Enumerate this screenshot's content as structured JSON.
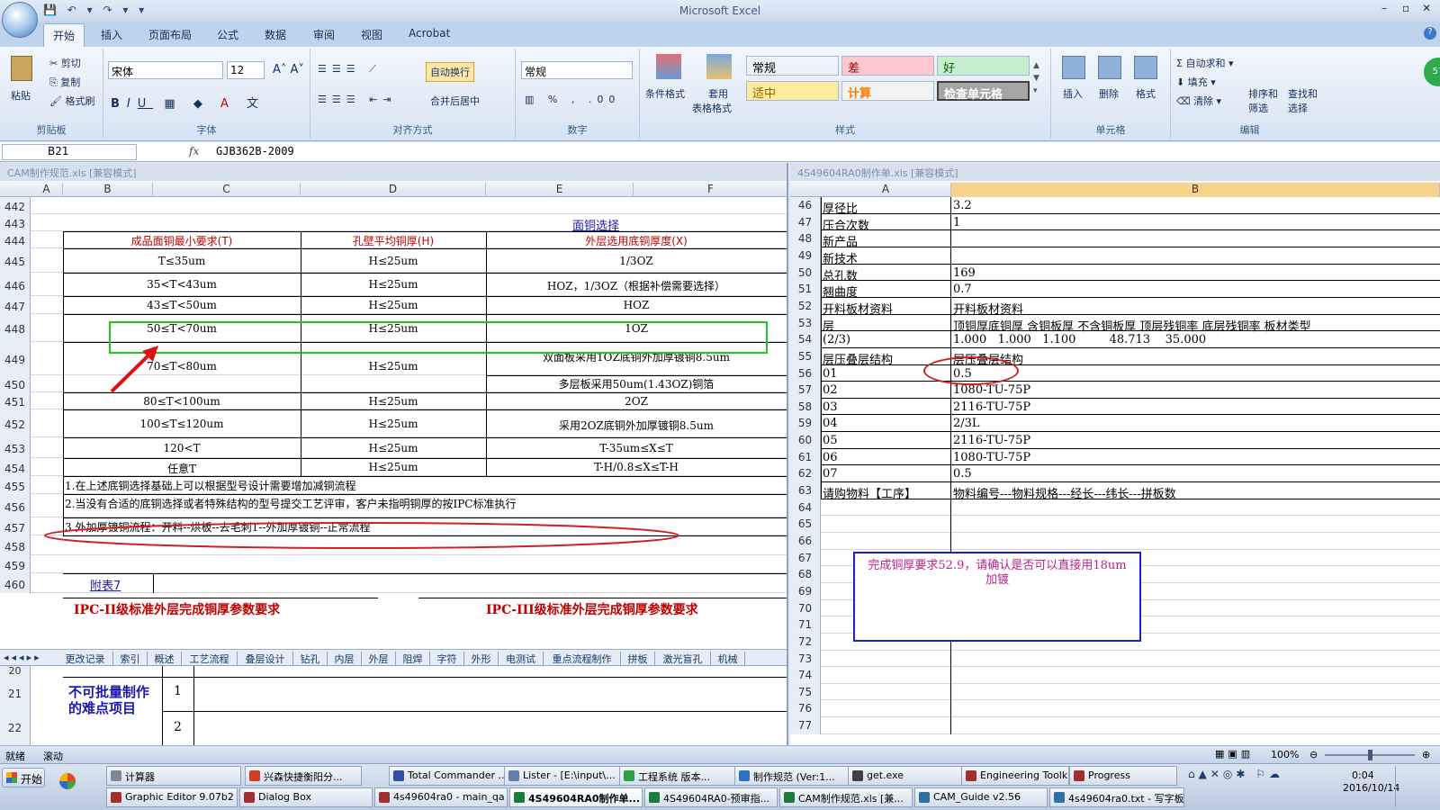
{
  "window": {
    "title": "Microsoft Excel"
  },
  "menu_tabs": [
    "开始",
    "插入",
    "页面布局",
    "公式",
    "数据",
    "审阅",
    "视图",
    "Acrobat"
  ],
  "ribbon": {
    "clipboard": {
      "paste": "粘贴",
      "cut": "剪切",
      "copy": "复制",
      "format_painter": "格式刷",
      "label": "剪贴板"
    },
    "font": {
      "name": "宋体",
      "size": "12",
      "label": "字体"
    },
    "alignment": {
      "wrap": "自动换行",
      "merge": "合并后居中",
      "label": "对齐方式"
    },
    "number": {
      "format": "常规",
      "label": "数字"
    },
    "styles": {
      "cond_format": "条件格式",
      "table_format_1": "套用",
      "table_format_2": "表格格式",
      "label": "样式",
      "items": [
        {
          "t": "常规",
          "bg": "#ffffff",
          "c": "#000000"
        },
        {
          "t": "差",
          "bg": "#ffc7ce",
          "c": "#9c0006"
        },
        {
          "t": "好",
          "bg": "#c6efce",
          "c": "#006100"
        },
        {
          "t": "适中",
          "bg": "#ffeb9c",
          "c": "#9c6500"
        },
        {
          "t": "计算",
          "bg": "#f2f2f2",
          "c": "#fa7d00"
        },
        {
          "t": "检查单元格",
          "bg": "#a5a5a5",
          "c": "#ffffff"
        }
      ]
    },
    "cells": {
      "insert": "插入",
      "delete": "删除",
      "format": "格式",
      "label": "单元格"
    },
    "editing": {
      "autosum": "自动求和",
      "fill": "填充",
      "clear": "清除",
      "sort1": "排序和",
      "sort2": "筛选",
      "find1": "查找和",
      "find2": "选择",
      "label": "编辑"
    }
  },
  "formula_bar": {
    "name_box": "B21",
    "fx": "fx",
    "value": "GJB362B-2009"
  },
  "left_window": {
    "title": "CAM制作规范.xls  [兼容模式]",
    "columns": [
      "A",
      "B",
      "C",
      "D",
      "E",
      "F"
    ],
    "rows": [
      "442",
      "443",
      "444",
      "445",
      "446",
      "447",
      "448",
      "449",
      "450",
      "451",
      "452",
      "453",
      "454",
      "455",
      "456",
      "457",
      "458",
      "459",
      "460"
    ],
    "section_title": "面铜选择",
    "headers": [
      "成品面铜最小要求(T)",
      "孔壁平均铜厚(H)",
      "外层选用底铜厚度(X)"
    ],
    "table": [
      [
        "T≤35um",
        "H≤25um",
        "1/3OZ"
      ],
      [
        "35<T<43um",
        "H≤25um",
        "HOZ，1/3OZ（根据补偿需要选择）"
      ],
      [
        "43≤T<50um",
        "H≤25um",
        "HOZ"
      ],
      [
        "50≤T<70um",
        "H≤25um",
        "1OZ"
      ],
      [
        "70≤T<80um",
        "H≤25um",
        "双面板采用1OZ底铜外加厚镀铜8.5um"
      ],
      [
        "",
        "",
        "多层板采用50um(1.43OZ)铜箔"
      ],
      [
        "80≤T<100um",
        "H≤25um",
        "2OZ"
      ],
      [
        "100≤T≤120um",
        "H≤25um",
        "采用2OZ底铜外加厚镀铜8.5um"
      ],
      [
        "120<T",
        "H≤25um",
        "T-35um≤X≤T"
      ],
      [
        "任意T",
        "H≤25um",
        "T-H/0.8≤X≤T-H"
      ]
    ],
    "notes": [
      "1.在上述底铜选择基础上可以根据型号设计需要增加减铜流程",
      "2.当没有合适的底铜选择或者特殊结构的型号提交工艺评审，客户未指明铜厚的按IPC标准执行",
      "3.外加厚镀铜流程：开料--烘板--去毛刺1--外加厚镀铜--正常流程"
    ],
    "appendix": "附表7",
    "ipc2": "IPC-II级标准外层完成铜厚参数要求",
    "ipc3": "IPC-III级标准外层完成铜厚参数要求",
    "sheet_tabs": [
      "更改记录",
      "索引",
      "概述",
      "工艺流程",
      "叠层设计",
      "钻孔",
      "内层",
      "外层",
      "阻焊",
      "字符",
      "外形",
      "电测试",
      "重点流程制作",
      "拼板",
      "激光盲孔",
      "机械"
    ]
  },
  "bottom_window": {
    "rows": [
      "20",
      "21",
      "22"
    ],
    "difficult": "不可批量制作的难点项目",
    "nums": [
      "1",
      "2"
    ]
  },
  "right_window": {
    "title": "4S49604RA0制作单.xls  [兼容模式]",
    "columns": [
      "A",
      "B"
    ],
    "rows": [
      [
        "46",
        "厚径比",
        "3.2"
      ],
      [
        "47",
        "压合次数",
        "1"
      ],
      [
        "48",
        "新产品",
        ""
      ],
      [
        "49",
        "新技术",
        ""
      ],
      [
        "50",
        "总孔数",
        "169"
      ],
      [
        "51",
        "翘曲度",
        "0.7"
      ],
      [
        "52",
        "开料板材资料",
        "开料板材资料"
      ],
      [
        "53",
        "层",
        "顶铜厚底铜厚 含铜板厚 不含铜板厚 顶层残铜率 底层残铜率 板材类型"
      ],
      [
        "54",
        "(2/3)",
        "1.000   1.000   1.100         48.713    35.000"
      ],
      [
        "55",
        "层压叠层结构",
        "层压叠层结构"
      ],
      [
        "56",
        "01",
        "0.5"
      ],
      [
        "57",
        "02",
        "1080-TU-75P"
      ],
      [
        "58",
        "03",
        "2116-TU-75P"
      ],
      [
        "59",
        "04",
        "2/3L"
      ],
      [
        "60",
        "05",
        "2116-TU-75P"
      ],
      [
        "61",
        "06",
        "1080-TU-75P"
      ],
      [
        "62",
        "07",
        "0.5"
      ],
      [
        "63",
        "请购物料【工序】",
        "物料编号---物料规格---经长---纬长---拼板数"
      ],
      [
        "64",
        "",
        ""
      ],
      [
        "65",
        "",
        ""
      ],
      [
        "66",
        "",
        ""
      ],
      [
        "67",
        "",
        ""
      ],
      [
        "68",
        "",
        ""
      ],
      [
        "69",
        "",
        ""
      ],
      [
        "70",
        "",
        ""
      ],
      [
        "71",
        "",
        ""
      ],
      [
        "72",
        "",
        ""
      ],
      [
        "73",
        "",
        ""
      ],
      [
        "74",
        "",
        ""
      ],
      [
        "75",
        "",
        ""
      ],
      [
        "76",
        "",
        ""
      ],
      [
        "77",
        "",
        ""
      ]
    ],
    "comment": "完成铜厚要求52.9，请确认是否可以直接用18um加镀"
  },
  "status": {
    "ready": "就绪",
    "scroll": "滚动",
    "zoom": "100%"
  },
  "taskbar": {
    "start": "开始",
    "row1": [
      {
        "t": "计算器",
        "c": "#7a8a9a"
      },
      {
        "t": "兴森快捷衡阳分...",
        "c": "#d04020"
      },
      {
        "t": "Total Commander ...",
        "c": "#3050a0"
      },
      {
        "t": "Lister - [E:\\input\\...",
        "c": "#6080b0"
      },
      {
        "t": "工程系统  版本...",
        "c": "#30a040"
      },
      {
        "t": "制作规范 (Ver:1...",
        "c": "#3070c0"
      },
      {
        "t": "get.exe",
        "c": "#404040"
      },
      {
        "t": "Engineering Toolki...",
        "c": "#a03030"
      },
      {
        "t": "Progress",
        "c": "#a03030"
      }
    ],
    "row2": [
      {
        "t": "Graphic Editor 9.07b2 (...",
        "c": "#a03030"
      },
      {
        "t": "Dialog Box",
        "c": "#a03030"
      },
      {
        "t": "4s49604ra0 - main_qa",
        "c": "#a03030"
      },
      {
        "t": "4S49604RA0制作单...",
        "c": "#1d7a3a",
        "active": true
      },
      {
        "t": "4S49604RA0-预审指...",
        "c": "#1d7a3a"
      },
      {
        "t": "CAM制作规范.xls [兼...",
        "c": "#1d7a3a"
      },
      {
        "t": "CAM_Guide v2.56",
        "c": "#3070a0"
      },
      {
        "t": "4s49604ra0.txt - 写字板",
        "c": "#3070a0"
      }
    ],
    "time": "0:04",
    "date": "2016/10/14"
  }
}
